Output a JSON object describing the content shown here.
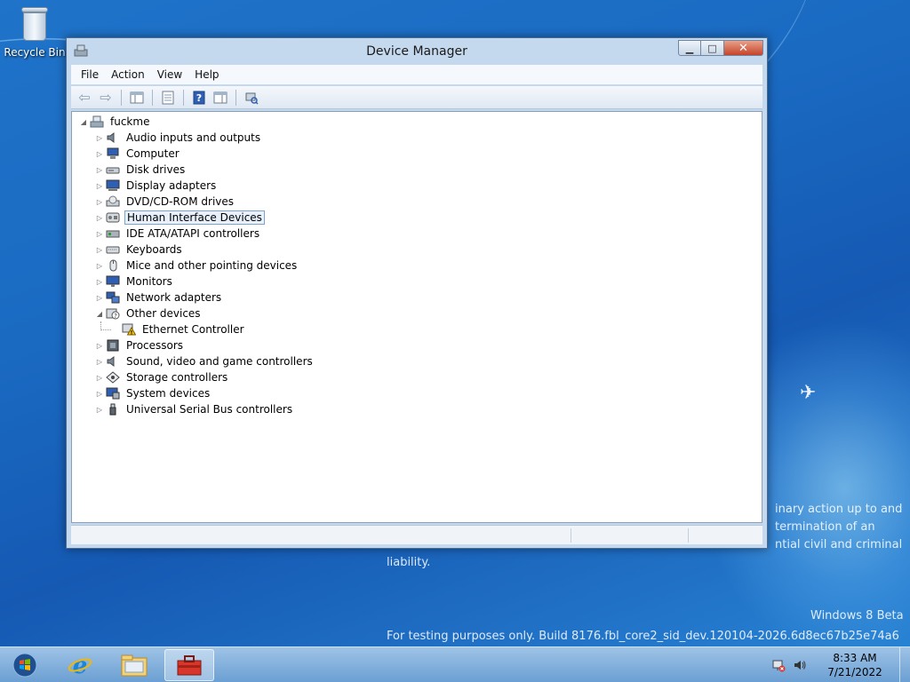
{
  "desktop": {
    "recycle_bin_label": "Recycle Bin",
    "watermark": {
      "line1": "inary action up to and",
      "line2": "termination of an",
      "line3": "ntial civil and criminal",
      "line4": "liability.",
      "os_name": "Windows 8 Beta",
      "build": "For testing purposes only. Build 8176.fbl_core2_sid_dev.120104-2026.6d8ec67b25e74a6"
    }
  },
  "window": {
    "title": "Device Manager",
    "caption": {
      "minimize": "▁",
      "maximize": "□",
      "close": "✕"
    },
    "menu": [
      "File",
      "Action",
      "View",
      "Help"
    ],
    "tree": {
      "root": "fuckme",
      "items": [
        {
          "label": "Audio inputs and outputs",
          "icon": "speaker-icon"
        },
        {
          "label": "Computer",
          "icon": "computer-icon"
        },
        {
          "label": "Disk drives",
          "icon": "disk-drive-icon"
        },
        {
          "label": "Display adapters",
          "icon": "display-adapter-icon"
        },
        {
          "label": "DVD/CD-ROM drives",
          "icon": "dvd-drive-icon"
        },
        {
          "label": "Human Interface Devices",
          "icon": "hid-icon",
          "selected": true
        },
        {
          "label": "IDE ATA/ATAPI controllers",
          "icon": "ide-controller-icon"
        },
        {
          "label": "Keyboards",
          "icon": "keyboard-icon"
        },
        {
          "label": "Mice and other pointing devices",
          "icon": "mouse-icon"
        },
        {
          "label": "Monitors",
          "icon": "monitor-icon"
        },
        {
          "label": "Network adapters",
          "icon": "network-adapter-icon"
        },
        {
          "label": "Other devices",
          "icon": "unknown-device-icon",
          "expanded": true
        },
        {
          "label": "Ethernet Controller",
          "icon": "warning-device-icon",
          "child": true
        },
        {
          "label": "Processors",
          "icon": "processor-icon"
        },
        {
          "label": "Sound, video and game controllers",
          "icon": "speaker-icon"
        },
        {
          "label": "Storage controllers",
          "icon": "storage-controller-icon"
        },
        {
          "label": "System devices",
          "icon": "system-devices-icon"
        },
        {
          "label": "Universal Serial Bus controllers",
          "icon": "usb-icon"
        }
      ]
    }
  },
  "taskbar": {
    "time": "8:33 AM",
    "date": "7/21/2022"
  }
}
